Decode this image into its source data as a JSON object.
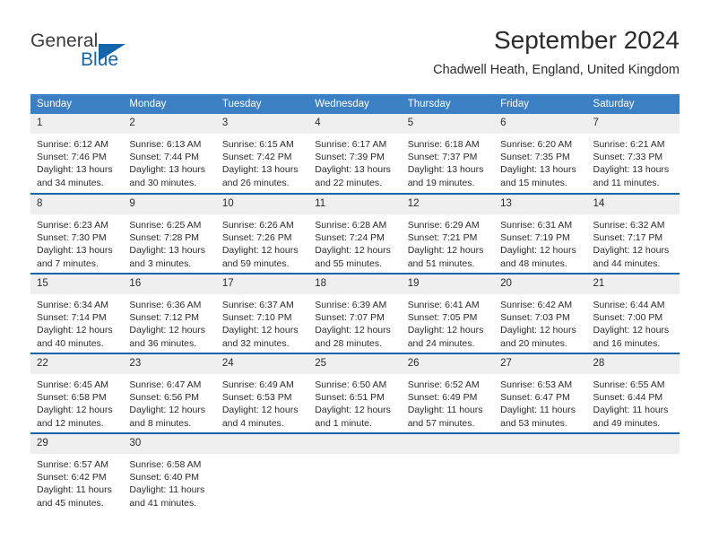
{
  "brand": {
    "name_part1": "General",
    "name_part2": "Blue",
    "accent_color": "#1464aa",
    "logo_icon": "triangle-flag-icon"
  },
  "header": {
    "month_title": "September 2024",
    "location": "Chadwell Heath, England, United Kingdom"
  },
  "calendar": {
    "header_bg": "#3b7fc4",
    "row_divider_color": "#1464aa",
    "daynum_bg": "#efefef",
    "weekday_headers": [
      "Sunday",
      "Monday",
      "Tuesday",
      "Wednesday",
      "Thursday",
      "Friday",
      "Saturday"
    ],
    "weeks": [
      [
        {
          "day": "1",
          "sunrise": "Sunrise: 6:12 AM",
          "sunset": "Sunset: 7:46 PM",
          "daylight": "Daylight: 13 hours and 34 minutes."
        },
        {
          "day": "2",
          "sunrise": "Sunrise: 6:13 AM",
          "sunset": "Sunset: 7:44 PM",
          "daylight": "Daylight: 13 hours and 30 minutes."
        },
        {
          "day": "3",
          "sunrise": "Sunrise: 6:15 AM",
          "sunset": "Sunset: 7:42 PM",
          "daylight": "Daylight: 13 hours and 26 minutes."
        },
        {
          "day": "4",
          "sunrise": "Sunrise: 6:17 AM",
          "sunset": "Sunset: 7:39 PM",
          "daylight": "Daylight: 13 hours and 22 minutes."
        },
        {
          "day": "5",
          "sunrise": "Sunrise: 6:18 AM",
          "sunset": "Sunset: 7:37 PM",
          "daylight": "Daylight: 13 hours and 19 minutes."
        },
        {
          "day": "6",
          "sunrise": "Sunrise: 6:20 AM",
          "sunset": "Sunset: 7:35 PM",
          "daylight": "Daylight: 13 hours and 15 minutes."
        },
        {
          "day": "7",
          "sunrise": "Sunrise: 6:21 AM",
          "sunset": "Sunset: 7:33 PM",
          "daylight": "Daylight: 13 hours and 11 minutes."
        }
      ],
      [
        {
          "day": "8",
          "sunrise": "Sunrise: 6:23 AM",
          "sunset": "Sunset: 7:30 PM",
          "daylight": "Daylight: 13 hours and 7 minutes."
        },
        {
          "day": "9",
          "sunrise": "Sunrise: 6:25 AM",
          "sunset": "Sunset: 7:28 PM",
          "daylight": "Daylight: 13 hours and 3 minutes."
        },
        {
          "day": "10",
          "sunrise": "Sunrise: 6:26 AM",
          "sunset": "Sunset: 7:26 PM",
          "daylight": "Daylight: 12 hours and 59 minutes."
        },
        {
          "day": "11",
          "sunrise": "Sunrise: 6:28 AM",
          "sunset": "Sunset: 7:24 PM",
          "daylight": "Daylight: 12 hours and 55 minutes."
        },
        {
          "day": "12",
          "sunrise": "Sunrise: 6:29 AM",
          "sunset": "Sunset: 7:21 PM",
          "daylight": "Daylight: 12 hours and 51 minutes."
        },
        {
          "day": "13",
          "sunrise": "Sunrise: 6:31 AM",
          "sunset": "Sunset: 7:19 PM",
          "daylight": "Daylight: 12 hours and 48 minutes."
        },
        {
          "day": "14",
          "sunrise": "Sunrise: 6:32 AM",
          "sunset": "Sunset: 7:17 PM",
          "daylight": "Daylight: 12 hours and 44 minutes."
        }
      ],
      [
        {
          "day": "15",
          "sunrise": "Sunrise: 6:34 AM",
          "sunset": "Sunset: 7:14 PM",
          "daylight": "Daylight: 12 hours and 40 minutes."
        },
        {
          "day": "16",
          "sunrise": "Sunrise: 6:36 AM",
          "sunset": "Sunset: 7:12 PM",
          "daylight": "Daylight: 12 hours and 36 minutes."
        },
        {
          "day": "17",
          "sunrise": "Sunrise: 6:37 AM",
          "sunset": "Sunset: 7:10 PM",
          "daylight": "Daylight: 12 hours and 32 minutes."
        },
        {
          "day": "18",
          "sunrise": "Sunrise: 6:39 AM",
          "sunset": "Sunset: 7:07 PM",
          "daylight": "Daylight: 12 hours and 28 minutes."
        },
        {
          "day": "19",
          "sunrise": "Sunrise: 6:41 AM",
          "sunset": "Sunset: 7:05 PM",
          "daylight": "Daylight: 12 hours and 24 minutes."
        },
        {
          "day": "20",
          "sunrise": "Sunrise: 6:42 AM",
          "sunset": "Sunset: 7:03 PM",
          "daylight": "Daylight: 12 hours and 20 minutes."
        },
        {
          "day": "21",
          "sunrise": "Sunrise: 6:44 AM",
          "sunset": "Sunset: 7:00 PM",
          "daylight": "Daylight: 12 hours and 16 minutes."
        }
      ],
      [
        {
          "day": "22",
          "sunrise": "Sunrise: 6:45 AM",
          "sunset": "Sunset: 6:58 PM",
          "daylight": "Daylight: 12 hours and 12 minutes."
        },
        {
          "day": "23",
          "sunrise": "Sunrise: 6:47 AM",
          "sunset": "Sunset: 6:56 PM",
          "daylight": "Daylight: 12 hours and 8 minutes."
        },
        {
          "day": "24",
          "sunrise": "Sunrise: 6:49 AM",
          "sunset": "Sunset: 6:53 PM",
          "daylight": "Daylight: 12 hours and 4 minutes."
        },
        {
          "day": "25",
          "sunrise": "Sunrise: 6:50 AM",
          "sunset": "Sunset: 6:51 PM",
          "daylight": "Daylight: 12 hours and 1 minute."
        },
        {
          "day": "26",
          "sunrise": "Sunrise: 6:52 AM",
          "sunset": "Sunset: 6:49 PM",
          "daylight": "Daylight: 11 hours and 57 minutes."
        },
        {
          "day": "27",
          "sunrise": "Sunrise: 6:53 AM",
          "sunset": "Sunset: 6:47 PM",
          "daylight": "Daylight: 11 hours and 53 minutes."
        },
        {
          "day": "28",
          "sunrise": "Sunrise: 6:55 AM",
          "sunset": "Sunset: 6:44 PM",
          "daylight": "Daylight: 11 hours and 49 minutes."
        }
      ],
      [
        {
          "day": "29",
          "sunrise": "Sunrise: 6:57 AM",
          "sunset": "Sunset: 6:42 PM",
          "daylight": "Daylight: 11 hours and 45 minutes."
        },
        {
          "day": "30",
          "sunrise": "Sunrise: 6:58 AM",
          "sunset": "Sunset: 6:40 PM",
          "daylight": "Daylight: 11 hours and 41 minutes."
        },
        {
          "day": "",
          "sunrise": "",
          "sunset": "",
          "daylight": ""
        },
        {
          "day": "",
          "sunrise": "",
          "sunset": "",
          "daylight": ""
        },
        {
          "day": "",
          "sunrise": "",
          "sunset": "",
          "daylight": ""
        },
        {
          "day": "",
          "sunrise": "",
          "sunset": "",
          "daylight": ""
        },
        {
          "day": "",
          "sunrise": "",
          "sunset": "",
          "daylight": ""
        }
      ]
    ]
  }
}
